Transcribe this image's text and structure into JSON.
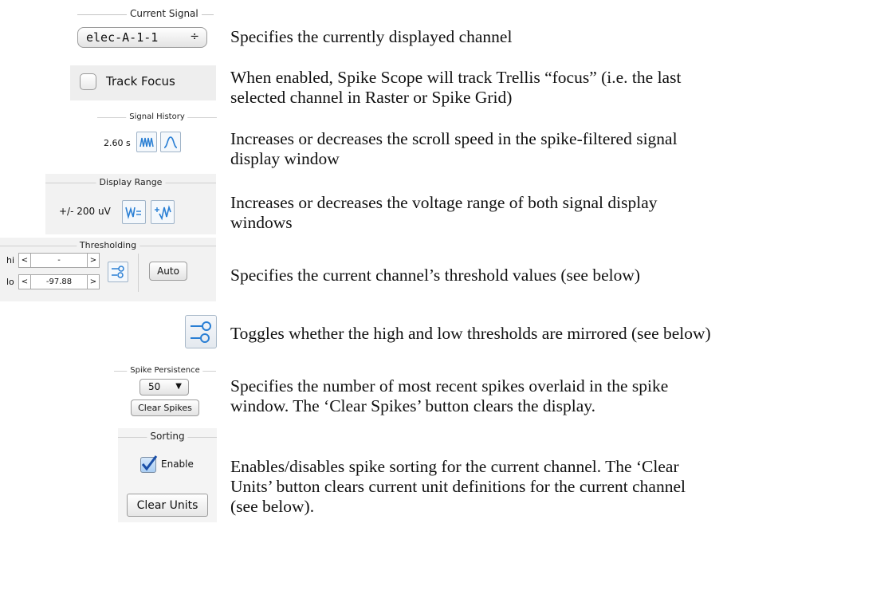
{
  "rows": [
    {
      "desc": [
        "Specifies the currently displayed channel"
      ]
    },
    {
      "desc": [
        "When enabled, Spike Scope will track Trellis “focus” (i.e. the last",
        "selected channel in Raster or Spike Grid)"
      ]
    },
    {
      "desc": [
        "Increases or decreases the scroll speed in the spike-filtered signal",
        "display window"
      ]
    },
    {
      "desc": [
        "Increases or decreases the voltage range of both signal display",
        "windows"
      ]
    },
    {
      "desc": [
        "Specifies the current channel’s threshold values (see below)"
      ]
    },
    {
      "desc": [
        "Toggles whether the high and low thresholds are mirrored (see below)"
      ]
    },
    {
      "desc": [
        "Specifies the number of most recent spikes overlaid in the spike",
        "window.  The ‘Clear Spikes’ button clears the display."
      ]
    },
    {
      "desc": [
        "Enables/disables spike sorting for the current channel.  The ‘Clear",
        "Units’ button clears current unit definitions for the current channel",
        "(see below)."
      ]
    }
  ],
  "current_signal": {
    "title": "Current Signal",
    "value": "elec-A-1-1",
    "arrows": "÷"
  },
  "track_focus": {
    "label": "Track Focus",
    "checked": false
  },
  "signal_history": {
    "title": "Signal History",
    "value": "2.60 s"
  },
  "display_range": {
    "title": "Display Range",
    "value": "+/- 200 uV"
  },
  "thresholding": {
    "title": "Thresholding",
    "hi_label": "hi",
    "lo_label": "lo",
    "hi_value": "-",
    "lo_value": "-97.88",
    "dec": "<",
    "inc": ">",
    "auto_label": "Auto"
  },
  "spike_persistence": {
    "title": "Spike Persistence",
    "value": "50",
    "dropdown_arrow": "▼",
    "clear_label": "Clear Spikes"
  },
  "sorting": {
    "title": "Sorting",
    "enable_label": "Enable",
    "enabled": true,
    "clear_label": "Clear Units"
  },
  "colors": {
    "icon_blue": "#2a7fd4",
    "checkbox_blue": "#1a73d9"
  }
}
